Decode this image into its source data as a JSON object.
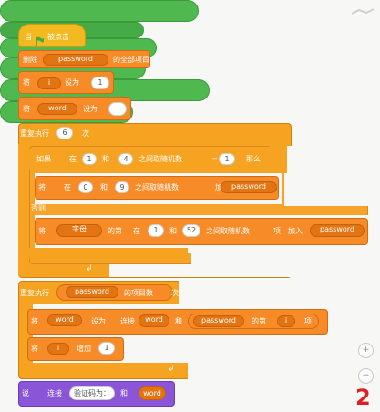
{
  "event": {
    "flag_label": "被点击"
  },
  "stmt1": {
    "label": "删除",
    "list": "password",
    "suffix": "的全部项目"
  },
  "stmt2": {
    "label": "将",
    "var": "i",
    "mid": "设为",
    "value": "1"
  },
  "stmt3": {
    "label": "将",
    "var": "word",
    "mid": "设为",
    "value": ""
  },
  "repeat1": {
    "label": "重复执行",
    "count": "6",
    "suffix": "次"
  },
  "if_block": {
    "label": "如果",
    "left_label": "在",
    "from": "1",
    "and": "和",
    "to": "4",
    "pick": "之间取随机数",
    "eq": "=",
    "value": "1",
    "then": "那么"
  },
  "add1": {
    "label": "将",
    "from_label": "在",
    "from": "0",
    "and": "和",
    "to": "9",
    "pick": "之间取随机数",
    "verb": "加入",
    "list": "password"
  },
  "else_label": "否则",
  "add2": {
    "label": "将",
    "text_label": "字母",
    "mid": "的第",
    "from_label": "在",
    "from": "1",
    "and": "和",
    "to": "52",
    "pick": "之间取随机数",
    "item": "项",
    "verb": "加入",
    "list": "password"
  },
  "repeat2": {
    "label": "重复执行",
    "list": "password",
    "suffix": "的项目数",
    "end": "次"
  },
  "set_word": {
    "label": "将",
    "var": "word",
    "mid": "设为",
    "join": "连接",
    "word": "word",
    "and": "和",
    "list": "password",
    "item_of": "的第",
    "i": "i",
    "item": "项"
  },
  "change_i": {
    "label": "将",
    "var": "i",
    "mid": "增加",
    "value": "1"
  },
  "say": {
    "label": "说",
    "join": "连接",
    "text": "验证码为：",
    "and": "和",
    "word": "word"
  },
  "zoom": {
    "in": "+",
    "out": "−"
  },
  "badge": "2",
  "colors": {
    "events": "#f3b921",
    "variables": "#f78b27",
    "control": "#f6a321",
    "looks": "#8a55d7",
    "operators": "#4fb950"
  }
}
